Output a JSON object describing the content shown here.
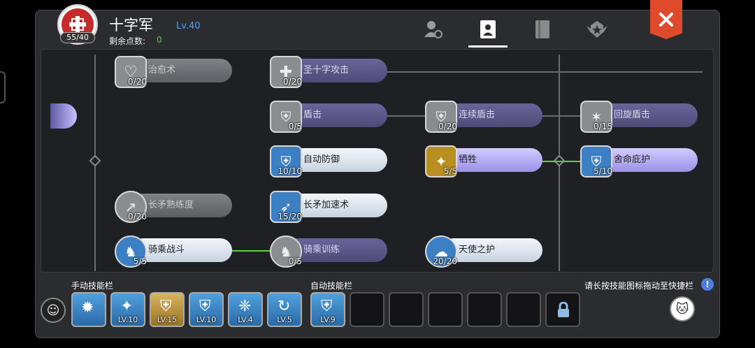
{
  "header": {
    "job_name": "十字军",
    "job_level": "Lv.40",
    "skill_points_badge": "55/40",
    "remaining_points_label": "剩余点数:",
    "remaining_points_value": "0"
  },
  "tabs": [
    {
      "icon": "character-icon",
      "active": false
    },
    {
      "icon": "skill-book-icon",
      "active": true
    },
    {
      "icon": "book-icon",
      "active": false
    },
    {
      "icon": "emblem-icon",
      "active": false
    }
  ],
  "close_icon": "close-icon",
  "skills": [
    {
      "name": "治愈术",
      "level": "0/20",
      "icon": "heal-icon"
    },
    {
      "name": "圣十字攻击",
      "level": "0/20",
      "icon": "holy-cross-icon"
    },
    {
      "name": "盾击",
      "level": "0/5",
      "icon": "shield-bash-icon"
    },
    {
      "name": "连续盾击",
      "level": "0/20",
      "icon": "combo-shield-icon"
    },
    {
      "name": "回旋盾击",
      "level": "0/15",
      "icon": "spin-shield-icon"
    },
    {
      "name": "自动防御",
      "level": "10/10",
      "icon": "auto-guard-icon"
    },
    {
      "name": "牺牲",
      "level": "5/5",
      "icon": "sacrifice-icon"
    },
    {
      "name": "舍命庇护",
      "level": "5/10",
      "icon": "devotion-icon"
    },
    {
      "name": "长矛熟练度",
      "level": "0/20",
      "icon": "spear-mastery-icon"
    },
    {
      "name": "长矛加速术",
      "level": "15/20",
      "icon": "spear-quicken-icon"
    },
    {
      "name": "骑乘战斗",
      "level": "5/5",
      "icon": "cavalry-combat-icon"
    },
    {
      "name": "骑乘训练",
      "level": "0/5",
      "icon": "riding-icon"
    },
    {
      "name": "天使之护",
      "level": "20/20",
      "icon": "angel-guard-icon"
    }
  ],
  "manual_bar": {
    "label": "手动技能栏",
    "slots": [
      {
        "icon": "strike-icon",
        "level": ""
      },
      {
        "icon": "star-burst-icon",
        "level": "LV.10"
      },
      {
        "icon": "gold-shield-icon",
        "level": "LV.15"
      },
      {
        "icon": "holy-shield-icon",
        "level": "LV.10"
      },
      {
        "icon": "winged-shield-icon",
        "level": "LV.4"
      },
      {
        "icon": "blue-swirl-icon",
        "level": "LV.5"
      }
    ]
  },
  "auto_bar": {
    "label": "自动技能栏",
    "slots": [
      {
        "icon": "auto-guard-icon",
        "level": "LV.9"
      },
      {
        "icon": "",
        "level": ""
      },
      {
        "icon": "",
        "level": ""
      },
      {
        "icon": "",
        "level": ""
      },
      {
        "icon": "",
        "level": ""
      },
      {
        "icon": "",
        "level": ""
      },
      {
        "icon": "lock-icon",
        "level": ""
      }
    ]
  },
  "hint": "请长按技能图标拖动至快捷栏",
  "colors": {
    "accent_blue": "#4aa3ff",
    "points_green": "#59d04a",
    "close_red": "#e04a2c",
    "link_green": "#5ad43a"
  }
}
